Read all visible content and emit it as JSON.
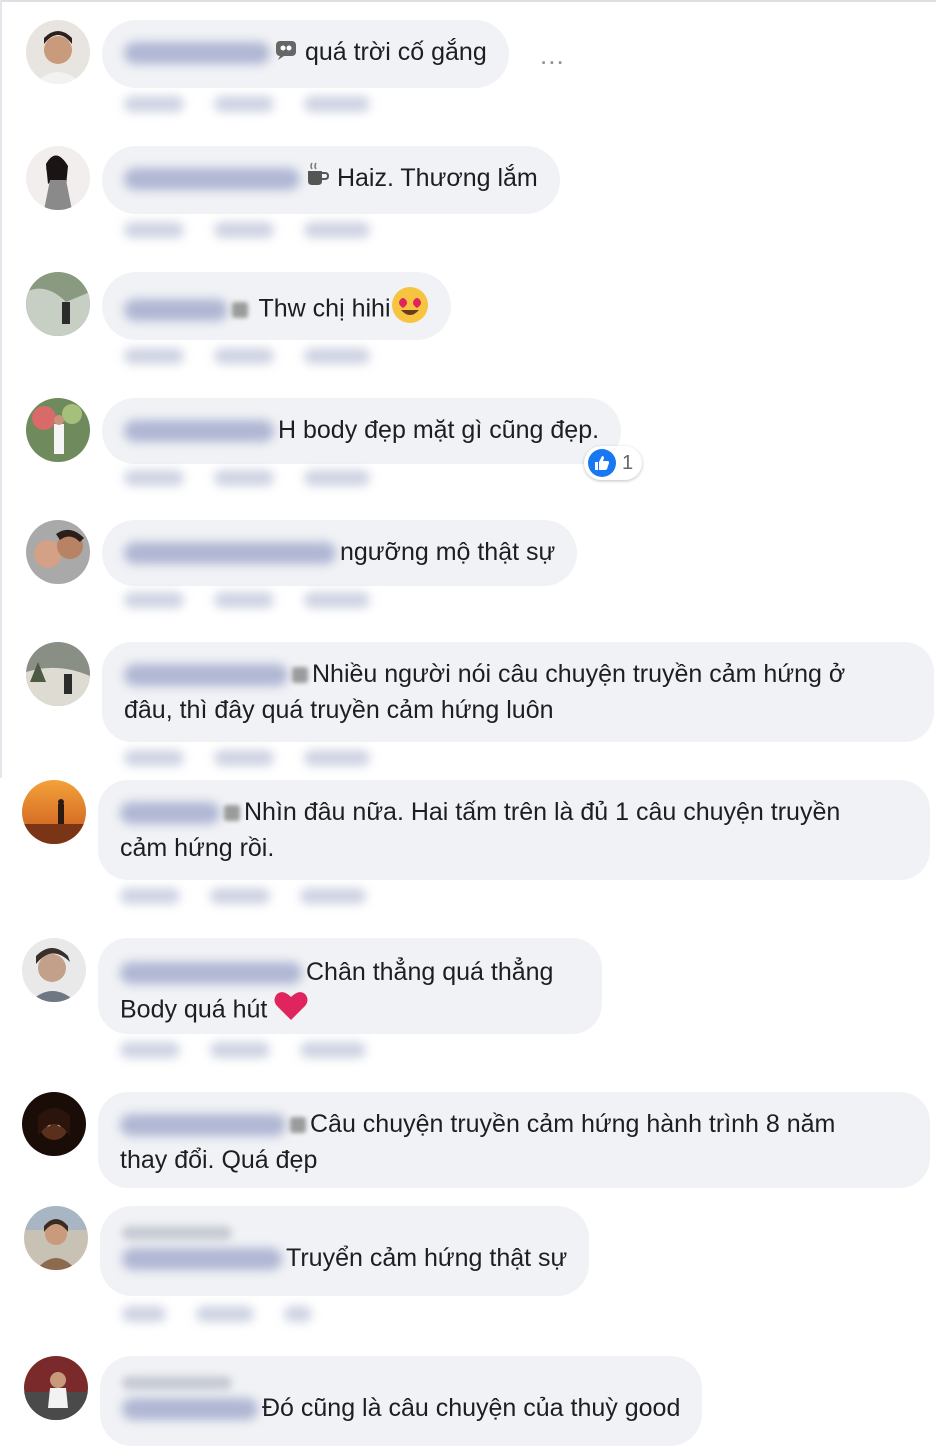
{
  "comments": [
    {
      "text": "quá trời cố gắng",
      "more_label": "..."
    },
    {
      "text": "Haiz. Thương lắm"
    },
    {
      "text": "Thw chị hihi"
    },
    {
      "text": "H body đẹp mặt gì cũng đẹp.",
      "reaction_count": "1"
    },
    {
      "text": "ngưỡng mộ thật sự"
    },
    {
      "line1": "Nhiều người nói câu chuyện truyền cảm hứng ở",
      "line2": "đâu, thì đây quá truyền cảm hứng luôn"
    },
    {
      "line1": "Nhìn đâu nữa. Hai tấm trên là đủ 1 câu chuyện truyền",
      "line2": "cảm hứng rồi."
    },
    {
      "line1": "Chân thẳng quá thẳng",
      "line2": "Body quá hút"
    },
    {
      "line1": "Câu chuyện truyền cảm hứng hành trình 8 năm",
      "line2": "thay đổi. Quá đẹp"
    },
    {
      "text": "Truyển cảm hứng thật sự"
    },
    {
      "text": "Đó cũng là câu chuyện của thuỳ good"
    }
  ],
  "colors": {
    "bubble": "#f0f2f5",
    "like": "#1877f2",
    "heart": "#e0245e"
  }
}
